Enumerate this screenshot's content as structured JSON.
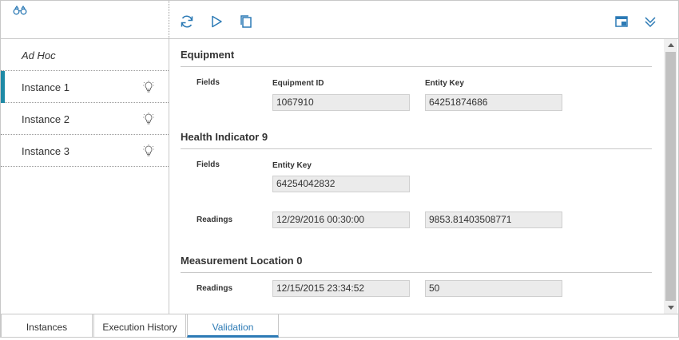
{
  "toolbar": {
    "icons": [
      "binoculars-icon",
      "refresh-icon",
      "play-icon",
      "copy-icon",
      "window-icon",
      "chevron-double-down-icon"
    ]
  },
  "sidebar": {
    "items": [
      {
        "label": "Ad Hoc"
      },
      {
        "label": "Instance 1"
      },
      {
        "label": "Instance 2"
      },
      {
        "label": "Instance 3"
      }
    ]
  },
  "equipment": {
    "title": "Equipment",
    "fields_label": "Fields",
    "col1_header": "Equipment ID",
    "col2_header": "Entity Key",
    "equipment_id": "1067910",
    "entity_key": "64251874686"
  },
  "health": {
    "title": "Health Indicator 9",
    "fields_label": "Fields",
    "col1_header": "Entity Key",
    "entity_key": "64254042832",
    "readings_label": "Readings",
    "reading_time": "12/29/2016 00:30:00",
    "reading_value": "9853.81403508771"
  },
  "measurement": {
    "title": "Measurement Location 0",
    "readings_label": "Readings",
    "reading_time": "12/15/2015 23:34:52",
    "reading_value": "50"
  },
  "tabs": [
    {
      "label": "Instances"
    },
    {
      "label": "Execution History"
    },
    {
      "label": "Validation"
    }
  ],
  "colors": {
    "accent": "#2c7ab5",
    "active_marker": "#1f8aa6"
  }
}
